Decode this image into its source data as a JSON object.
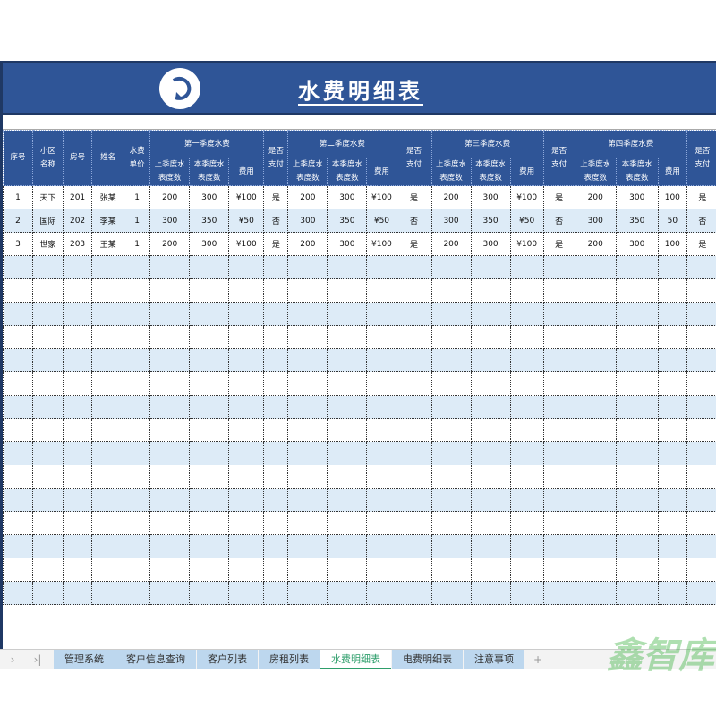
{
  "title": "水费明细表",
  "headers": {
    "seq": "序号",
    "area": "小区\n名称",
    "room": "房号",
    "name": "姓名",
    "price": "水费\n单价",
    "prev": "上季度水\n表度数",
    "curr": "本季度水\n表度数",
    "fee": "费用",
    "paid": "是否\n支付",
    "quarters": [
      "第一季度水费",
      "第二季度水费",
      "第三季度水费",
      "第四季度水费"
    ]
  },
  "rows": [
    [
      "1",
      "天下",
      "201",
      "张某",
      "1",
      "200",
      "300",
      "¥100",
      "是",
      "200",
      "300",
      "¥100",
      "是",
      "200",
      "300",
      "¥100",
      "是",
      "200",
      "300",
      "100",
      "是"
    ],
    [
      "2",
      "国际",
      "202",
      "李某",
      "1",
      "300",
      "350",
      "¥50",
      "否",
      "300",
      "350",
      "¥50",
      "否",
      "300",
      "350",
      "¥50",
      "否",
      "300",
      "350",
      "50",
      "否"
    ],
    [
      "3",
      "世家",
      "203",
      "王某",
      "1",
      "200",
      "300",
      "¥100",
      "是",
      "200",
      "300",
      "¥100",
      "是",
      "200",
      "300",
      "¥100",
      "是",
      "200",
      "300",
      "100",
      "是"
    ]
  ],
  "tabs": [
    "管理系统",
    "客户信息查询",
    "客户列表",
    "房租列表",
    "水费明细表",
    "电费明细表",
    "注意事项"
  ],
  "active_tab": 4,
  "watermark": "鑫智库",
  "colors": {
    "header": "#2f5597",
    "alt_row": "#ddebf7",
    "active_tab": "#2e9e6b"
  }
}
